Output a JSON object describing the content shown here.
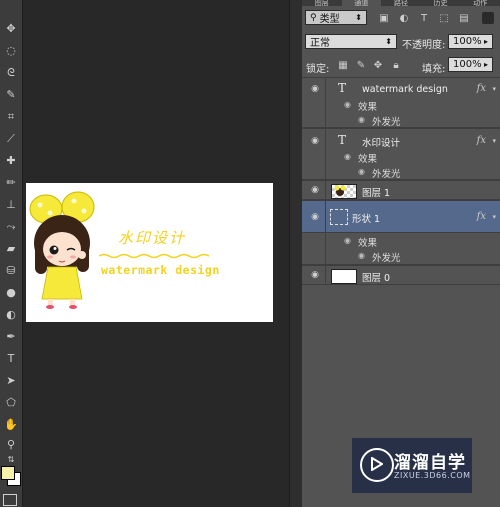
{
  "tabs": [
    "图层",
    "通道",
    "路径",
    "历史",
    "动作"
  ],
  "filter": {
    "label": "类型",
    "icons": [
      "image-filter-icon",
      "adjustment-filter-icon",
      "type-filter-icon",
      "shape-filter-icon",
      "smart-object-filter-icon"
    ]
  },
  "blend": {
    "mode": "正常",
    "opacity_label": "不透明度:",
    "opacity_value": "100%"
  },
  "lock": {
    "label": "锁定:",
    "fill_label": "填充:",
    "fill_value": "100%"
  },
  "layers": [
    {
      "name": "watermark design",
      "type": "text",
      "fx": "fx",
      "effects_label": "效果",
      "effect": "外发光"
    },
    {
      "name": "水印设计",
      "type": "text",
      "fx": "fx",
      "effects_label": "效果",
      "effect": "外发光"
    },
    {
      "name": "图层 1",
      "type": "image"
    },
    {
      "name": "形状 1",
      "type": "shape",
      "fx": "fx",
      "effects_label": "效果",
      "effect": "外发光",
      "selected": true
    },
    {
      "name": "图层 0",
      "type": "image"
    }
  ],
  "canvas": {
    "title": "水印设计",
    "subtitle": "watermark design"
  },
  "watermark": {
    "title": "溜溜自学",
    "url": "ZIXUE.3D66.COM"
  },
  "colors": {
    "foreground": "#f6f0a8",
    "background": "#ffffff",
    "accent": "#f5d21f",
    "selected": "#55698d"
  }
}
